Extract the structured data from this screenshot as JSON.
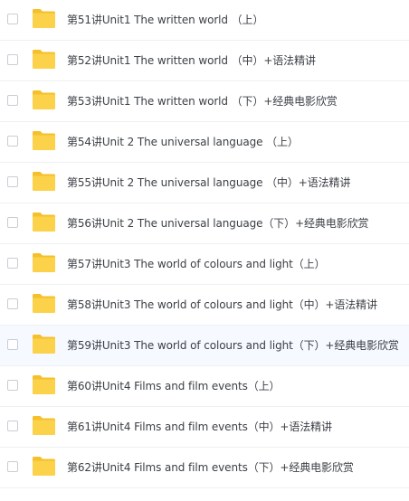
{
  "files": [
    {
      "name": "第51讲Unit1 The written world （上）",
      "icon": "folder-icon"
    },
    {
      "name": "第52讲Unit1 The written world （中）+语法精讲",
      "icon": "folder-icon"
    },
    {
      "name": "第53讲Unit1 The written world （下）+经典电影欣赏",
      "icon": "folder-icon"
    },
    {
      "name": "第54讲Unit 2 The universal language （上）",
      "icon": "folder-icon"
    },
    {
      "name": "第55讲Unit 2 The universal language （中）+语法精讲",
      "icon": "folder-icon"
    },
    {
      "name": "第56讲Unit 2 The universal language（下）+经典电影欣赏",
      "icon": "folder-icon"
    },
    {
      "name": "第57讲Unit3 The world of colours and light（上）",
      "icon": "folder-icon"
    },
    {
      "name": "第58讲Unit3 The world of colours and light（中）+语法精讲",
      "icon": "folder-icon"
    },
    {
      "name": "第59讲Unit3 The world of colours and light（下）+经典电影欣赏",
      "icon": "folder-icon"
    },
    {
      "name": "第60讲Unit4 Films and film events（上）",
      "icon": "folder-icon"
    },
    {
      "name": "第61讲Unit4 Films and film events（中）+语法精讲",
      "icon": "folder-icon"
    },
    {
      "name": "第62讲Unit4 Films and film events（下）+经典电影欣赏",
      "icon": "folder-icon"
    }
  ],
  "colors": {
    "folder": "#fcd24a",
    "folder_dark": "#f5c02b",
    "text": "#3b3f45",
    "hover_row": "#f6f9ff",
    "divider": "#eef0f3",
    "checkbox_border": "#c9cdd4"
  }
}
